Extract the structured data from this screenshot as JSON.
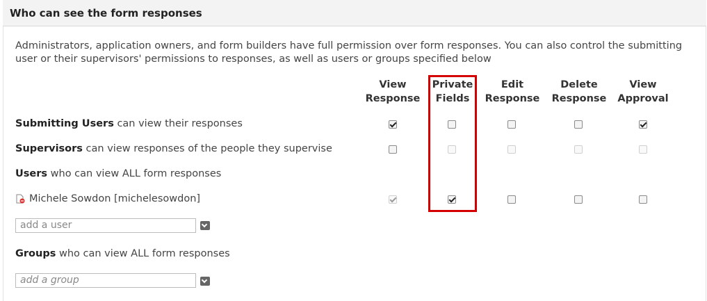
{
  "header": {
    "title": "Who can see the form responses"
  },
  "intro": "Administrators, application owners, and form builders have full permission over form responses. You can also control the submitting user or their supervisors' permissions to responses, as well as users or groups specified below",
  "columns": [
    {
      "line1": "View",
      "line2": "Response"
    },
    {
      "line1": "Private",
      "line2": "Fields"
    },
    {
      "line1": "Edit",
      "line2": "Response"
    },
    {
      "line1": "Delete",
      "line2": "Response"
    },
    {
      "line1": "View",
      "line2": "Approval"
    }
  ],
  "rows": {
    "submitting": {
      "bold": "Submitting Users",
      "rest": "can view their responses",
      "checks": [
        {
          "checked": true,
          "disabled": false
        },
        {
          "checked": false,
          "disabled": false
        },
        {
          "checked": false,
          "disabled": false
        },
        {
          "checked": false,
          "disabled": false
        },
        {
          "checked": true,
          "disabled": false
        }
      ]
    },
    "supervisors": {
      "bold": "Supervisors",
      "rest": "can view responses of the people they supervise",
      "checks": [
        {
          "checked": false,
          "disabled": false
        },
        {
          "checked": false,
          "disabled": true
        },
        {
          "checked": false,
          "disabled": true
        },
        {
          "checked": false,
          "disabled": true
        },
        {
          "checked": false,
          "disabled": true
        }
      ]
    },
    "users_heading": {
      "bold": "Users",
      "rest": "who can view ALL form responses"
    },
    "user": {
      "name": "Michele Sowdon [michelesowdon]",
      "checks": [
        {
          "checked": true,
          "disabled": true
        },
        {
          "checked": true,
          "disabled": false
        },
        {
          "checked": false,
          "disabled": false
        },
        {
          "checked": false,
          "disabled": false
        },
        {
          "checked": false,
          "disabled": false
        }
      ]
    },
    "groups_heading": {
      "bold": "Groups",
      "rest": "who can view ALL form responses"
    }
  },
  "add_user": {
    "placeholder": "add a user"
  },
  "add_group": {
    "placeholder": "add a group"
  },
  "colors": {
    "highlight": "#d40000",
    "header_bg": "#f3f3f3"
  },
  "icons": {
    "user": "remove-user-icon",
    "dropdown": "chevron-down-icon"
  }
}
